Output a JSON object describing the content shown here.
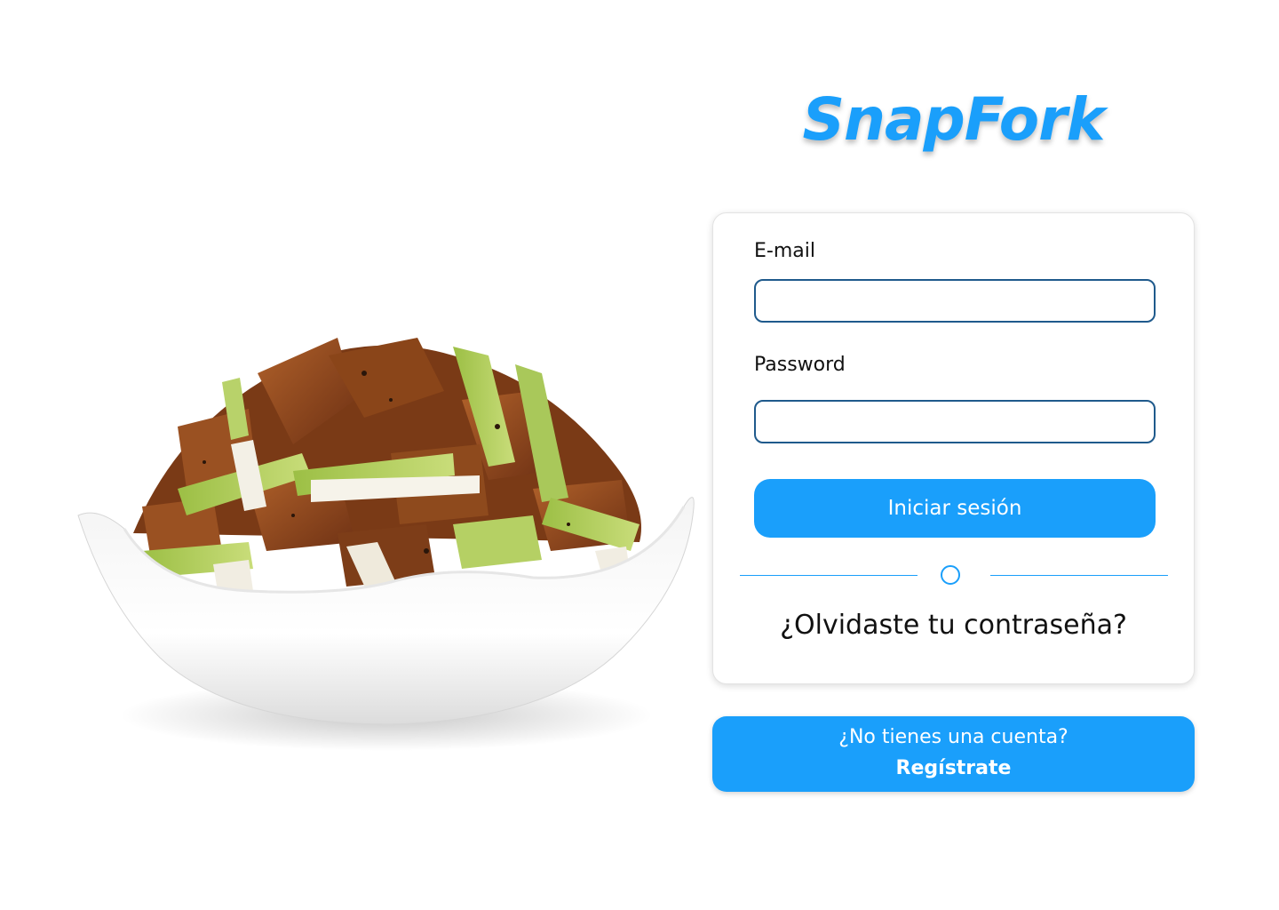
{
  "app": {
    "brand_name": "SnapFork",
    "brand_color": "#1a9ffb"
  },
  "hero_image": {
    "icon": "food-bowl-illustration"
  },
  "login_form": {
    "email_label": "E-mail",
    "email_value": "",
    "password_label": "Password",
    "password_value": "",
    "submit_label": "Iniciar sesión",
    "forgot_password_label": "¿Olvidaste tu contraseña?"
  },
  "register": {
    "question": "¿No tienes una cuenta?",
    "link_label": "Regístrate"
  }
}
